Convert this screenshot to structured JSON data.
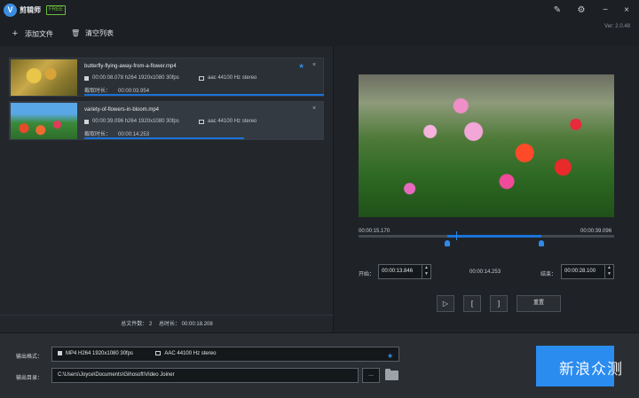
{
  "app": {
    "name": "剪辑师",
    "badge": "FREE",
    "version": "Ver: 2.0.48",
    "logo_letter": "V"
  },
  "window_controls": {
    "skin_icon": "✎",
    "settings_icon": "⚙",
    "minimize_icon": "−",
    "close_icon": "×"
  },
  "toolbar": {
    "add_files": "添加文件",
    "add_icon": "+",
    "clear_list": "清空列表",
    "clear_icon": "🗑"
  },
  "files": [
    {
      "name": "butterfly-flying-away-from-a-flower.mp4",
      "video_info": "00:00:08.078 h264 1920x1080 30fps",
      "audio_info": "aac 44100 Hz stereo",
      "duration_label": "截取时长：",
      "duration": "00:00:03.954",
      "starred": true
    },
    {
      "name": "variety-of-flowers-in-bloom.mp4",
      "video_info": "00:00:39.096 h264 1920x1080 30fps",
      "audio_info": "aac 44100 Hz stereo",
      "duration_label": "截取时长：",
      "duration": "00:00:14.253",
      "starred": false
    }
  ],
  "totals": {
    "count_label": "总文件数：",
    "count": "2",
    "duration_label": "总时长：",
    "duration": "00:00:18.208"
  },
  "preview": {
    "timeline_start": "00:00:15.170",
    "timeline_end": "00:00:39.096",
    "start_label": "开始：",
    "start_value": "00:00:13.846",
    "current_value": "00:00:14.253",
    "end_label": "结束：",
    "end_value": "00:00:28.100",
    "play_icon": "▷",
    "mark_in": "[",
    "mark_out": "]",
    "reset_label": "重置"
  },
  "output": {
    "format_label": "输出格式：",
    "format_video": "MP4 H264 1920x1080 30fps",
    "format_audio": "AAC 44100 Hz stereo",
    "dir_label": "输出目录：",
    "dir_value": "C:\\Users\\Joyce\\Documents\\Gihosoft\\Video Joiner",
    "browse": "...",
    "watermark": "新浪众测"
  },
  "colors": {
    "accent": "#2b8cf0",
    "background": "#1f2328"
  }
}
